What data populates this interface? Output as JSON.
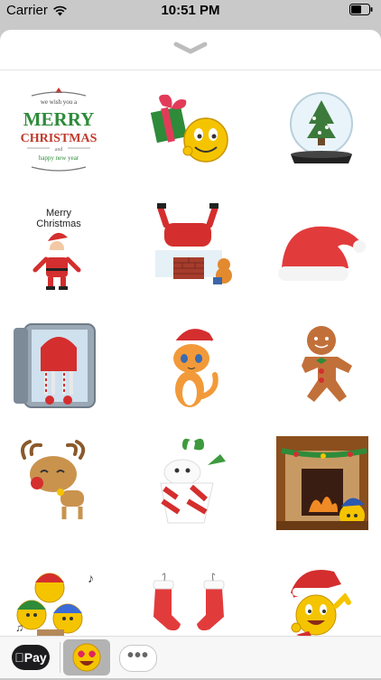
{
  "status": {
    "carrier": "Carrier",
    "time": "10:51 PM"
  },
  "stickers": [
    {
      "name": "merry-christmas-card-sticker",
      "line1": "we wish you a",
      "line2": "MERRY",
      "line3": "CHRISTMAS",
      "line4": "and",
      "line5": "happy new year"
    },
    {
      "name": "emoji-with-gift-sticker"
    },
    {
      "name": "snow-globe-sticker"
    },
    {
      "name": "santa-merry-christmas-sticker",
      "line1": "Merry",
      "line2": "Christmas"
    },
    {
      "name": "santa-in-chimney-sticker"
    },
    {
      "name": "santa-hat-sticker"
    },
    {
      "name": "fridge-elf-sticker"
    },
    {
      "name": "kitten-santa-hat-sticker"
    },
    {
      "name": "gingerbread-man-sticker"
    },
    {
      "name": "reindeer-sticker"
    },
    {
      "name": "bunny-in-gift-box-sticker"
    },
    {
      "name": "fireplace-emoji-sticker"
    },
    {
      "name": "caroling-emojis-sticker"
    },
    {
      "name": "christmas-stockings-sticker"
    },
    {
      "name": "emoji-santa-hat-sticker"
    }
  ],
  "bottom": {
    "applepay": "Pay"
  },
  "colors": {
    "red": "#d42e2e",
    "green": "#2e8b3a",
    "yellow": "#f5c400",
    "sheet": "#ffffff"
  }
}
